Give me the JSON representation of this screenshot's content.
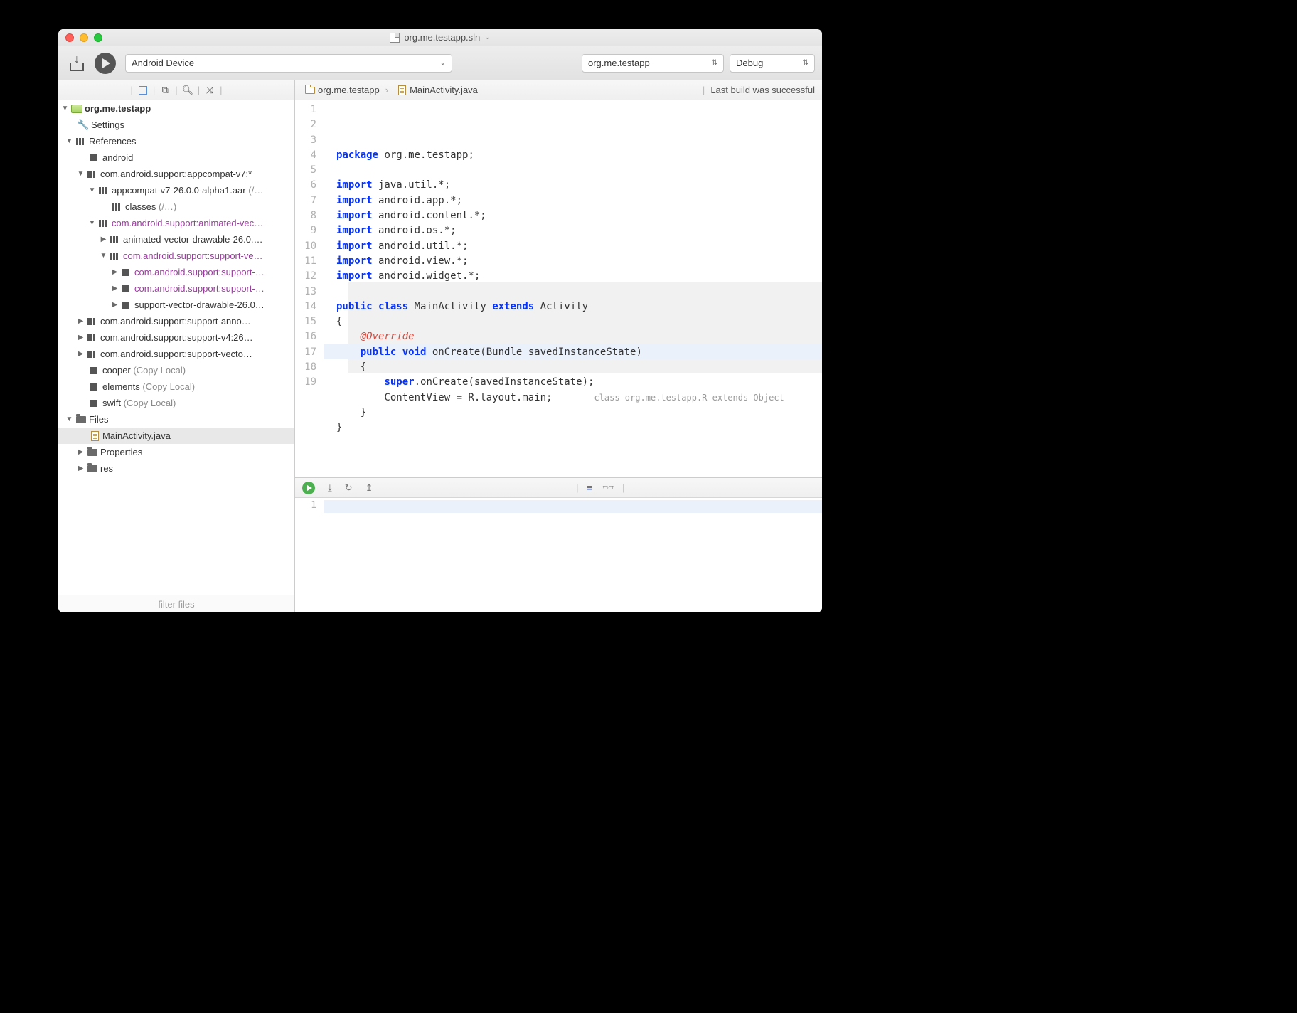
{
  "window": {
    "title": "org.me.testapp.sln"
  },
  "toolbar": {
    "device": "Android Device",
    "project": "org.me.testapp",
    "config": "Debug"
  },
  "sidebar": {
    "filter_placeholder": "filter files",
    "project": "org.me.testapp",
    "settings": "Settings",
    "references": "References",
    "refs": {
      "android": "android",
      "appcompat": "com.android.support:appcompat-v7:*",
      "appcompat_aar": "appcompat-v7-26.0.0-alpha1.aar",
      "appcompat_aar_suffix": "(/…",
      "classes": "classes",
      "classes_suffix": "(/…)",
      "animated": "com.android.support:animated-vec…",
      "animated_drawable": "animated-vector-drawable-26.0.…",
      "support_ve": "com.android.support:support-ve…",
      "support_child1": "com.android.support:support-…",
      "support_child2": "com.android.support:support-…",
      "support_vector_draw": "support-vector-drawable-26.0…",
      "support_anno": "com.android.support:support-anno…",
      "support_v4": "com.android.support:support-v4:26…",
      "support_vecto": "com.android.support:support-vecto…",
      "cooper": "cooper",
      "elements": "elements",
      "swift": "swift",
      "copy_local": "(Copy Local)"
    },
    "files": "Files",
    "main_activity": "MainActivity.java",
    "properties": "Properties",
    "res": "res"
  },
  "breadcrumb": {
    "project": "org.me.testapp",
    "file": "MainActivity.java",
    "status": "Last build was successful"
  },
  "editor": {
    "lines": [
      "1",
      "2",
      "3",
      "4",
      "5",
      "6",
      "7",
      "8",
      "9",
      "10",
      "11",
      "12",
      "13",
      "14",
      "15",
      "16",
      "17",
      "18",
      "19"
    ],
    "code": {
      "l1_kw": "package",
      "l1_rest": " org.me.testapp;",
      "import_kw": "import",
      "l3": " java.util.*;",
      "l4": " android.app.*;",
      "l5": " android.content.*;",
      "l6": " android.os.*;",
      "l7": " android.util.*;",
      "l8": " android.view.*;",
      "l9": " android.widget.*;",
      "l11_public": "public",
      "l11_class": "class",
      "l11_name": " MainActivity ",
      "l11_extends": "extends",
      "l11_base": " Activity",
      "l12": "{",
      "l13_ann": "@Override",
      "l14_public": "public",
      "l14_void": "void",
      "l14_sig": " onCreate(Bundle savedInstanceState)",
      "l15": "    {",
      "l16_super": "super",
      "l16_rest": ".onCreate(savedInstanceState);",
      "l17": "        ContentView = R.layout.main;",
      "l17_hint": "class org.me.testapp.R extends Object",
      "l18": "    }",
      "l19": "}"
    }
  },
  "panel": {
    "line1": "1"
  }
}
